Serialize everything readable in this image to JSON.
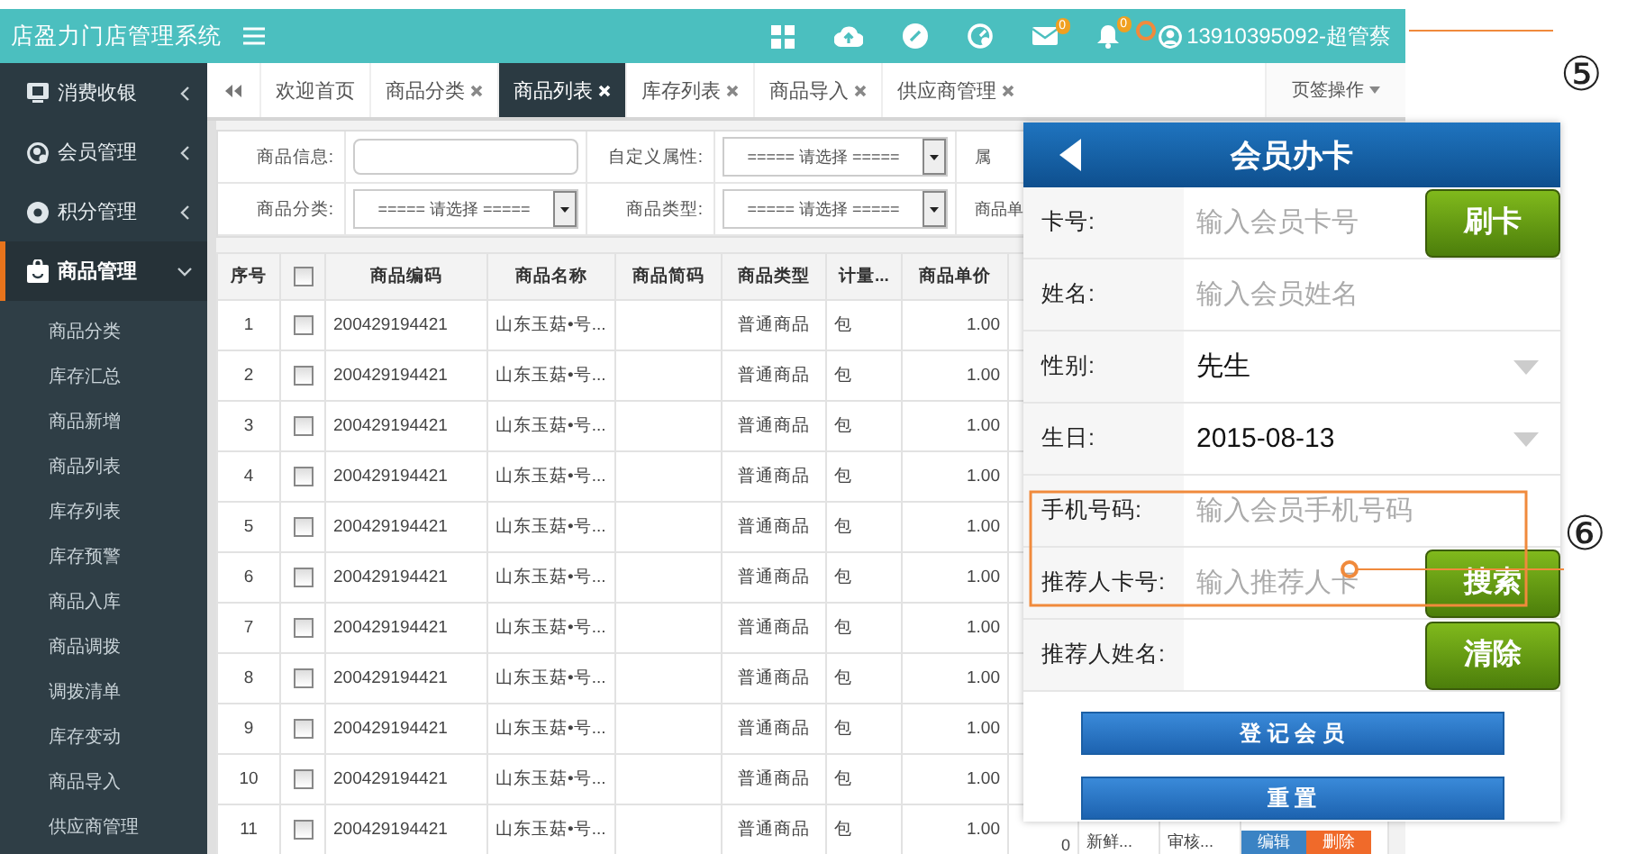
{
  "topbar": {
    "title": "店盈力门店管理系统",
    "icons": [
      {
        "kind": "grid"
      },
      {
        "kind": "cloud"
      },
      {
        "kind": "link"
      },
      {
        "kind": "gauge"
      },
      {
        "kind": "mail",
        "badge": "0"
      },
      {
        "kind": "bell",
        "badge": "0"
      }
    ],
    "user": "13910395092-超管蔡"
  },
  "sidebar": {
    "items": [
      {
        "kind": "monitor",
        "label": "消费收银",
        "expanded": false,
        "selected": false
      },
      {
        "kind": "member",
        "label": "会员管理",
        "expanded": false,
        "selected": false
      },
      {
        "kind": "points",
        "label": "积分管理",
        "expanded": false,
        "selected": false
      },
      {
        "kind": "bag",
        "label": "商品管理",
        "expanded": true,
        "selected": true,
        "children": [
          {
            "label": "商品分类",
            "selected": false
          },
          {
            "label": "库存汇总",
            "selected": false
          },
          {
            "label": "商品新增",
            "selected": false
          },
          {
            "label": "商品列表",
            "selected": false
          },
          {
            "label": "库存列表",
            "selected": false
          },
          {
            "label": "库存预警",
            "selected": false
          },
          {
            "label": "商品入库",
            "selected": false
          },
          {
            "label": "商品调拨",
            "selected": false
          },
          {
            "label": "调拨清单",
            "selected": false
          },
          {
            "label": "库存变动",
            "selected": false
          },
          {
            "label": "商品导入",
            "selected": false
          },
          {
            "label": "供应商管理",
            "selected": false
          }
        ]
      }
    ]
  },
  "tabs": [
    {
      "label": "欢迎首页",
      "closable": false,
      "selected": false
    },
    {
      "label": "商品分类",
      "closable": true,
      "selected": false
    },
    {
      "label": "商品列表",
      "closable": true,
      "selected": true
    },
    {
      "label": "库存列表",
      "closable": true,
      "selected": false
    },
    {
      "label": "商品导入",
      "closable": true,
      "selected": false
    },
    {
      "label": "供应商管理",
      "closable": true,
      "selected": false
    }
  ],
  "tab_menu": "页签操作",
  "filters": [
    [
      {
        "kind": "input",
        "label": "商品信息:"
      },
      {
        "kind": "select",
        "label": "自定义属性:",
        "value": "===== 请选择 ====="
      },
      {
        "kind": "label",
        "label": "属"
      }
    ],
    [
      {
        "kind": "select",
        "label": "商品分类:",
        "value": "===== 请选择 ====="
      },
      {
        "kind": "select",
        "label": "商品类型:",
        "value": "===== 请选择 ====="
      },
      {
        "kind": "label",
        "label": "商品单"
      }
    ]
  ],
  "table": {
    "columns": [
      {
        "kind": "text",
        "label": "序号"
      },
      {
        "kind": "checkbox",
        "checked": false
      },
      {
        "kind": "text",
        "label": "商品编码"
      },
      {
        "kind": "text",
        "label": "商品名称"
      },
      {
        "kind": "text",
        "label": "商品简码"
      },
      {
        "kind": "text",
        "label": "商品类型"
      },
      {
        "kind": "text",
        "label": "计量..."
      },
      {
        "kind": "text",
        "label": "商品单价"
      }
    ],
    "rows": [
      {
        "no": "1",
        "checked": false,
        "code": "200429194421",
        "name": "山东玉菇•号...",
        "type": "普通商品",
        "unit": "包",
        "price": "1.00"
      },
      {
        "no": "2",
        "checked": false,
        "code": "200429194421",
        "name": "山东玉菇•号...",
        "type": "普通商品",
        "unit": "包",
        "price": "1.00"
      },
      {
        "no": "3",
        "checked": false,
        "code": "200429194421",
        "name": "山东玉菇•号...",
        "type": "普通商品",
        "unit": "包",
        "price": "1.00"
      },
      {
        "no": "4",
        "checked": false,
        "code": "200429194421",
        "name": "山东玉菇•号...",
        "type": "普通商品",
        "unit": "包",
        "price": "1.00"
      },
      {
        "no": "5",
        "checked": false,
        "code": "200429194421",
        "name": "山东玉菇•号...",
        "type": "普通商品",
        "unit": "包",
        "price": "1.00"
      },
      {
        "no": "6",
        "checked": false,
        "code": "200429194421",
        "name": "山东玉菇•号...",
        "type": "普通商品",
        "unit": "包",
        "price": "1.00"
      },
      {
        "no": "7",
        "checked": false,
        "code": "200429194421",
        "name": "山东玉菇•号...",
        "type": "普通商品",
        "unit": "包",
        "price": "1.00"
      },
      {
        "no": "8",
        "checked": false,
        "code": "200429194421",
        "name": "山东玉菇•号...",
        "type": "普通商品",
        "unit": "包",
        "price": "1.00"
      },
      {
        "no": "9",
        "checked": false,
        "code": "200429194421",
        "name": "山东玉菇•号...",
        "type": "普通商品",
        "unit": "包",
        "price": "1.00"
      },
      {
        "no": "10",
        "checked": false,
        "code": "200429194421",
        "name": "山东玉菇•号...",
        "type": "普通商品",
        "unit": "包",
        "price": "1.00"
      },
      {
        "no": "11",
        "checked": false,
        "code": "200429194421",
        "name": "山东玉菇•号...",
        "type": "普通商品",
        "unit": "包",
        "price": "1.00",
        "column_9": "0",
        "column_10": "新鲜...",
        "column_11": "审核...",
        "actions": [
          {
            "kind": "edit",
            "label": "编辑"
          },
          {
            "kind": "delete",
            "label": "删除"
          }
        ]
      }
    ]
  },
  "member_card_dialog": {
    "title": "会员办卡",
    "fields": [
      {
        "kind": "input",
        "label": "卡号:",
        "placeholder": "输入会员卡号",
        "button": "刷卡"
      },
      {
        "kind": "input",
        "label": "姓名:",
        "placeholder": "输入会员姓名"
      },
      {
        "kind": "select",
        "label": "性别:",
        "value": "先生"
      },
      {
        "kind": "select",
        "label": "生日:",
        "value": "2015-08-13"
      },
      {
        "kind": "input",
        "label": "手机号码:",
        "placeholder": "输入会员手机号码"
      },
      {
        "kind": "input",
        "label": "推荐人卡号:",
        "placeholder": "输入推荐人卡",
        "button": "搜索"
      },
      {
        "kind": "input",
        "label": "推荐人姓名:",
        "button": "清除"
      }
    ],
    "buttons": [
      "登 记 会 员",
      "重 置"
    ]
  },
  "annotations": [
    {
      "label": "⑤"
    },
    {
      "label": "⑥"
    }
  ]
}
